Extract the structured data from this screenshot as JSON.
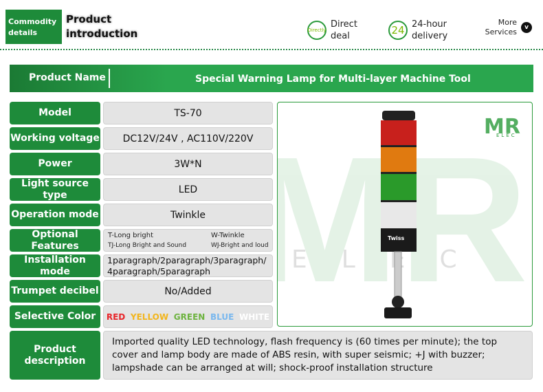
{
  "header": {
    "tab_commodity": "Commodity details",
    "tab_product": "Product introduction",
    "services": [
      {
        "icon": "directly-icon",
        "icon_text": "Directly",
        "label": "Direct deal"
      },
      {
        "icon": "24-icon",
        "icon_text": "24",
        "label": "24-hour delivery"
      }
    ],
    "more": "More Services"
  },
  "product_name": {
    "label": "Product Name",
    "value": "Special Warning Lamp for Multi-layer Machine Tool"
  },
  "specs": [
    {
      "label": "Model",
      "value": "TS-70"
    },
    {
      "label": "Working voltage",
      "value": "DC12V/24V , AC110V/220V"
    },
    {
      "label": "Power",
      "value": "3W*N"
    },
    {
      "label": "Light source type",
      "value": "LED"
    },
    {
      "label": "Operation mode",
      "value": "Twinkle"
    },
    {
      "label": "Optional Features",
      "options": [
        "T-Long bright",
        "W-Twinkle",
        "TJ-Long Bright and Sound",
        "WJ-Bright and loud"
      ]
    },
    {
      "label": "Installation mode",
      "value": "1paragraph/2paragraph/3paragraph/ 4paragraph/5paragraph"
    },
    {
      "label": "Trumpet decibel",
      "value": "No/Added"
    },
    {
      "label": "Selective Color",
      "colors": [
        {
          "name": "RED",
          "hex": "#e8262a"
        },
        {
          "name": "YELLOW",
          "hex": "#f2b51c"
        },
        {
          "name": "GREEN",
          "hex": "#6db33f"
        },
        {
          "name": "BLUE",
          "hex": "#7ab8ee"
        },
        {
          "name": "WHITE",
          "hex": "#ffffff"
        }
      ]
    }
  ],
  "description": {
    "label": "Product description",
    "value": "Imported quality LED technology, flash frequency is (60 times per minute); the top cover and lamp body are made of ABS resin, with super seismic; +J with buzzer; lampshade can be arranged at will; shock-proof installation structure"
  },
  "image": {
    "logo": "MR ELEC",
    "brand": "Twiss"
  }
}
